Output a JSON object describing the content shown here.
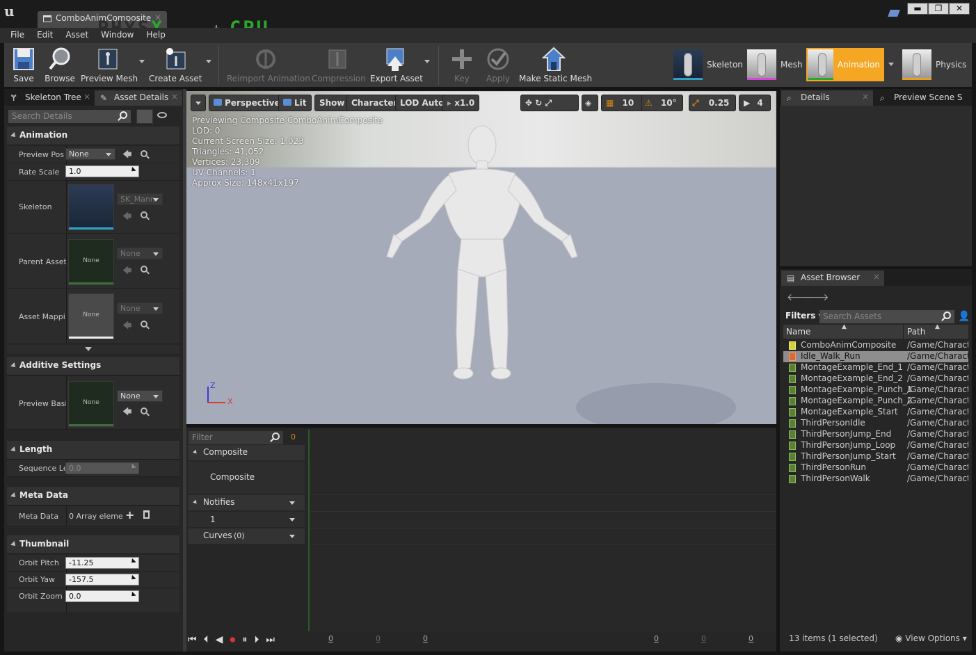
{
  "window": {
    "tab_title": "ComboAnimComposite",
    "physx": "PHYS",
    "physx_x": "X",
    "plus": "+",
    "cpu": "CPU",
    "min": "▬",
    "max": "❐",
    "close": "✕"
  },
  "menu": [
    "File",
    "Edit",
    "Asset",
    "Window",
    "Help"
  ],
  "toolbar": {
    "save": "Save",
    "browse": "Browse",
    "preview_mesh": "Preview Mesh",
    "create_asset": "Create Asset",
    "reimport": "Reimport Animation",
    "compression": "Compression",
    "export": "Export Asset",
    "key": "Key",
    "apply": "Apply",
    "make_static": "Make Static Mesh",
    "modes": {
      "skeleton": "Skeleton",
      "mesh": "Mesh",
      "animation": "Animation",
      "physics": "Physics"
    }
  },
  "left": {
    "tabs": {
      "skeleton_tree": "Skeleton Tree",
      "asset_details": "Asset Details"
    },
    "search_placeholder": "Search Details",
    "animation": {
      "title": "Animation",
      "preview_pos": "Preview Pos",
      "preview_pos_val": "None",
      "rate_scale": "Rate Scale",
      "rate_scale_val": "1.0",
      "skeleton": "Skeleton",
      "skeleton_val": "SK_Mann",
      "parent_asset": "Parent Asset",
      "parent_val": "None",
      "parent_thumb": "None",
      "asset_mapping": "Asset Mappi",
      "mapping_val": "None",
      "mapping_thumb": "None"
    },
    "additive": {
      "title": "Additive Settings",
      "preview_base": "Preview Basi",
      "base_val": "None",
      "base_thumb": "None"
    },
    "length": {
      "title": "Length",
      "sequence": "Sequence Le",
      "sequence_val": "0.0"
    },
    "meta": {
      "title": "Meta Data",
      "meta": "Meta Data",
      "meta_val": "0 Array eleme"
    },
    "thumbnail": {
      "title": "Thumbnail",
      "pitch": "Orbit Pitch",
      "pitch_val": "-11.25",
      "yaw": "Orbit Yaw",
      "yaw_val": "-157.5",
      "zoom": "Orbit Zoom",
      "zoom_val": "0.0"
    }
  },
  "viewport": {
    "buttons": {
      "perspective": "Perspective",
      "lit": "Lit",
      "show": "Show",
      "character": "Character",
      "lod": "LOD Auto",
      "speed": "x1.0",
      "grid": "10",
      "angle": "10°",
      "scale": "0.25",
      "cam": "4"
    },
    "stats": [
      "Previewing Composite ComboAnimComposite",
      "LOD: 0",
      "Current Screen Size: 1.023",
      "Triangles: 41,052",
      "Vertices: 23,309",
      "UV Channels: 1",
      "Approx Size: 148x41x197"
    ],
    "axis": {
      "z": "Z",
      "x": "X"
    }
  },
  "editor": {
    "filter_placeholder": "Filter",
    "count": "0",
    "composite_header": "Composite",
    "composite_track": "Composite",
    "notifies": "Notifies",
    "notify_track": "1",
    "curves": "Curves",
    "curves_count": "(0)",
    "ticks": [
      "0",
      "0",
      "0",
      "0",
      "0",
      "0"
    ]
  },
  "right": {
    "details_tab": "Details",
    "preview_tab": "Preview Scene S",
    "asset_browser_tab": "Asset Browser",
    "filters": "Filters",
    "search_placeholder": "Search Assets",
    "col_name": "Name",
    "col_path": "Path",
    "assets": [
      {
        "name": "ComboAnimComposite",
        "path": "/Game/Charact"
      },
      {
        "name": "Idle_Walk_Run",
        "path": "/Game/Charact"
      },
      {
        "name": "MontageExample_End_1",
        "path": "/Game/Charact"
      },
      {
        "name": "MontageExample_End_2",
        "path": "/Game/Charact"
      },
      {
        "name": "MontageExample_Punch_1",
        "path": "/Game/Charact"
      },
      {
        "name": "MontageExample_Punch_2",
        "path": "/Game/Charact"
      },
      {
        "name": "MontageExample_Start",
        "path": "/Game/Charact"
      },
      {
        "name": "ThirdPersonIdle",
        "path": "/Game/Charact"
      },
      {
        "name": "ThirdPersonJump_End",
        "path": "/Game/Charact"
      },
      {
        "name": "ThirdPersonJump_Loop",
        "path": "/Game/Charact"
      },
      {
        "name": "ThirdPersonJump_Start",
        "path": "/Game/Charact"
      },
      {
        "name": "ThirdPersonRun",
        "path": "/Game/Charact"
      },
      {
        "name": "ThirdPersonWalk",
        "path": "/Game/Charact"
      }
    ],
    "status": "13 items (1 selected)",
    "view_options": "View Options"
  },
  "colors": {
    "accent": "#f5a623",
    "selection": "#8e8e8e",
    "green": "#2aa82a"
  }
}
